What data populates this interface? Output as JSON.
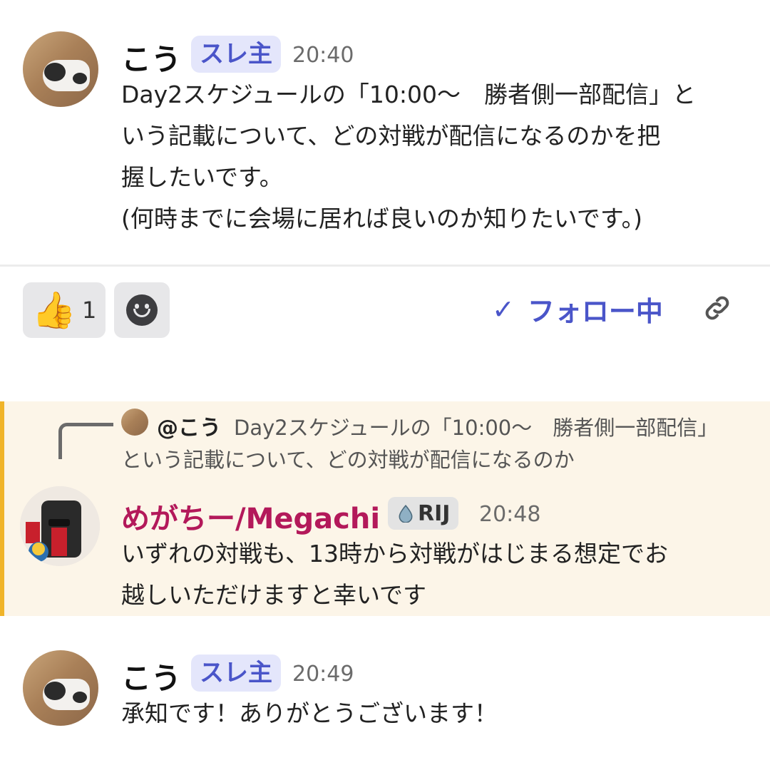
{
  "messages": [
    {
      "author": "こう",
      "badge": "スレ主",
      "time": "20:40",
      "lines": [
        "Day2スケジュールの「10:00〜　勝者側一部配信」と",
        "いう記載について、どの対戦が配信になるのかを把",
        "握したいです。",
        "(何時までに会場に居れば良いのか知りたいです。)"
      ]
    },
    {
      "author": "めがちー/Megachi",
      "role": "RIJ",
      "time": "20:48",
      "reply_to": {
        "author": "@こう",
        "line1": "Day2スケジュールの「10:00〜　勝者側一部配信」",
        "line2": "という記載について、どの対戦が配信になるのか"
      },
      "lines": [
        "いずれの対戦も、13時から対戦がはじまる想定でお",
        "越しいただけますと幸いです"
      ]
    },
    {
      "author": "こう",
      "badge": "スレ主",
      "time": "20:49",
      "lines": [
        "承知です！ありがとうございます！"
      ]
    }
  ],
  "reactions": {
    "thumbs_up_count": "1",
    "thumbs_up_emoji": "👍",
    "add_reaction_icon": "smiley-add-icon"
  },
  "follow": {
    "check": "✓",
    "label": "フォロー中"
  },
  "colors": {
    "accent": "#4a55c9",
    "badge_bg": "#e4e6fb",
    "reply_name": "#b3195a",
    "reply_bg": "#fcf5e8",
    "reply_bar": "#f0b429"
  }
}
